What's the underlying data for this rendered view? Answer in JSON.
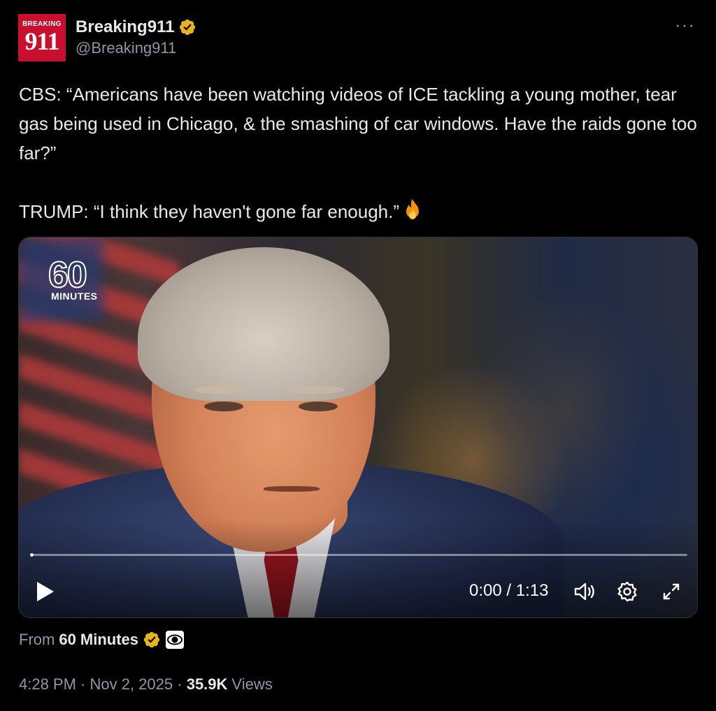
{
  "author": {
    "display_name": "Breaking911",
    "handle": "@Breaking911",
    "avatar_text_top": "BREAKING",
    "avatar_text_main": "911",
    "verified": true
  },
  "more_icon": "more-horizontal-icon",
  "tweet": {
    "line1": "CBS: “Americans have been watching videos of ICE tackling a young mother, tear gas being used in Chicago, & the smashing of car windows. Have the raids gone too far?”",
    "line2": "TRUMP: “I think they haven't gone far enough.”",
    "emoji": "fire-icon"
  },
  "video": {
    "logo_number": "60",
    "logo_word": "MINUTES",
    "time": "0:00 / 1:13",
    "progress": 0.0,
    "icons": [
      "play-icon",
      "volume-icon",
      "settings-icon",
      "fullscreen-icon"
    ]
  },
  "source": {
    "prefix": "From",
    "name": "60 Minutes",
    "verified": true,
    "network_icon": "cbs-eye-icon"
  },
  "meta": {
    "time": "4:28 PM",
    "separator1": " · ",
    "date": "Nov 2, 2025",
    "separator2": " · ",
    "views_count": "35.9K",
    "views_label": "Views"
  },
  "colors": {
    "background": "#000000",
    "text": "#e7e9ea",
    "secondary": "#8b98a5",
    "verified_gold": "#e8b419",
    "avatar_red": "#c8102e"
  }
}
